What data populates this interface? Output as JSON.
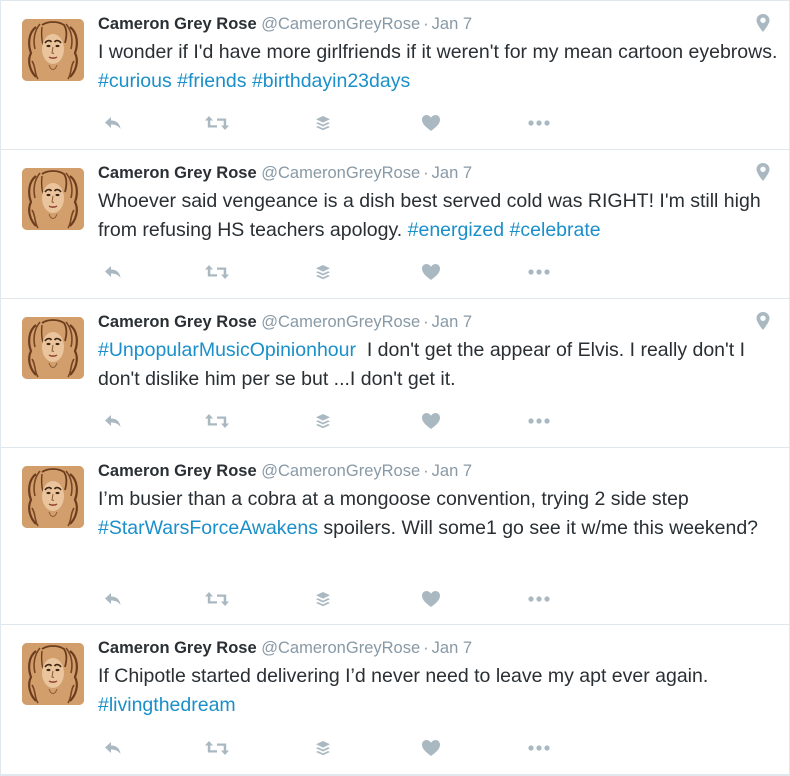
{
  "colors": {
    "hashtag": "#1a8fc9",
    "name": "#292f33",
    "meta": "#8899a6",
    "icon": "#aab8c2",
    "border": "#e1e8ed"
  },
  "tweets": [
    {
      "name": "Cameron Grey Rose",
      "handle": "@CameronGreyRose",
      "separator": "·",
      "date": "Jan 7",
      "segments": [
        {
          "t": "I wonder if I'd have more girlfriends if it weren't for my mean cartoon eyebrows. "
        },
        {
          "t": "#curious",
          "h": true
        },
        {
          "t": " "
        },
        {
          "t": "#friends",
          "h": true
        },
        {
          "t": " "
        },
        {
          "t": "#birthdayin23days",
          "h": true
        }
      ],
      "has_location": true,
      "icons": [
        "reply-icon",
        "retweet-icon",
        "buffer-icon",
        "like-icon",
        "more-icon"
      ]
    },
    {
      "name": "Cameron Grey Rose",
      "handle": "@CameronGreyRose",
      "separator": "·",
      "date": "Jan 7",
      "segments": [
        {
          "t": "Whoever said vengeance is a dish best served cold was RIGHT! I'm still high from refusing HS teachers apology. "
        },
        {
          "t": "#energized",
          "h": true
        },
        {
          "t": " "
        },
        {
          "t": "#celebrate",
          "h": true
        }
      ],
      "has_location": true,
      "icons": [
        "reply-icon",
        "retweet-icon",
        "buffer-icon",
        "like-icon",
        "more-icon"
      ]
    },
    {
      "name": "Cameron Grey Rose",
      "handle": "@CameronGreyRose",
      "separator": "·",
      "date": "Jan 7",
      "segments": [
        {
          "t": "#UnpopularMusicOpinionhour",
          "h": true
        },
        {
          "t": "  I don't get the appear of Elvis. I really don't I don't dislike him per se but ...I don't get it."
        }
      ],
      "has_location": true,
      "icons": [
        "reply-icon",
        "retweet-icon",
        "buffer-icon",
        "like-icon",
        "more-icon"
      ]
    },
    {
      "name": "Cameron Grey Rose",
      "handle": "@CameronGreyRose",
      "separator": "·",
      "date": "Jan 7",
      "segments": [
        {
          "t": "I’m busier than a cobra at a mongoose convention, trying 2 side step "
        },
        {
          "t": "#StarWarsForceAwakens",
          "h": true
        },
        {
          "t": " spoilers. Will some1 go see it w/me this weekend?"
        }
      ],
      "has_location": false,
      "icons": [
        "reply-icon",
        "retweet-icon",
        "buffer-icon",
        "like-icon",
        "more-icon"
      ]
    },
    {
      "name": "Cameron Grey Rose",
      "handle": "@CameronGreyRose",
      "separator": "·",
      "date": "Jan 7",
      "segments": [
        {
          "t": "If Chipotle started delivering I’d never need to leave my apt ever again. "
        },
        {
          "t": "#livingthedream",
          "h": true
        }
      ],
      "has_location": false,
      "icons": [
        "reply-icon",
        "retweet-icon",
        "buffer-icon",
        "like-icon",
        "more-icon"
      ]
    }
  ]
}
